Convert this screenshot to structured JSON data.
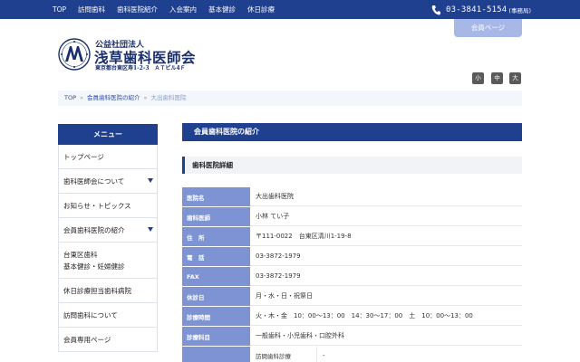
{
  "topnav": {
    "items": [
      "TOP",
      "訪問歯科",
      "歯科医院紹介",
      "入会案内",
      "基本健診",
      "休日診療"
    ],
    "phone": "03-3841-5154",
    "phone_note": "(事務局)"
  },
  "member_page_label": "会員ページ",
  "logo": {
    "small": "公益社団法人",
    "main": "浅草歯科医師会",
    "address": "東京都台東区寿1-2-3　ＡＴビル4Ｆ"
  },
  "font_size": {
    "small": "小",
    "medium": "中",
    "large": "大"
  },
  "breadcrumb": {
    "home": "TOP",
    "parent": "会員歯科医院の紹介",
    "current": "大出歯科医院"
  },
  "sidebar": {
    "title": "メニュー",
    "items": [
      {
        "label": "トップページ"
      },
      {
        "label": "歯科医師会について"
      },
      {
        "label": "お知らせ・トピックス"
      },
      {
        "label": "会員歯科医院の紹介"
      },
      {
        "label_line1": "台東区歯科",
        "label_line2": "基本健診・妊婦健診"
      },
      {
        "label": "休日診療担当歯科病院"
      },
      {
        "label": "訪問歯科について"
      },
      {
        "label": "会員専用ページ"
      }
    ]
  },
  "main": {
    "section_title": "会員歯科医院の紹介",
    "subsection_title": "歯科医院詳細",
    "rows": [
      {
        "key": "医院名",
        "value": "大出歯科医院"
      },
      {
        "key": "歯科医師",
        "value": "小林 てい子"
      },
      {
        "key": "住　所",
        "value": "〒111-0022　台東区清川1-19-8"
      },
      {
        "key": "電　話",
        "value": "03-3872-1979"
      },
      {
        "key": "FAX",
        "value": "03-3872-1979"
      },
      {
        "key": "休診日",
        "value": "月・水・日・祝祭日"
      },
      {
        "key": "診療時間",
        "value": "火・木・金　10：00～13：00　14：30～17：00　土　10：00～13：00"
      },
      {
        "key": "診療科目",
        "value": "一般歯科・小児歯科・口腔外科"
      },
      {
        "key": "",
        "value": "訪問歯科診療",
        "value2": "-"
      }
    ]
  }
}
